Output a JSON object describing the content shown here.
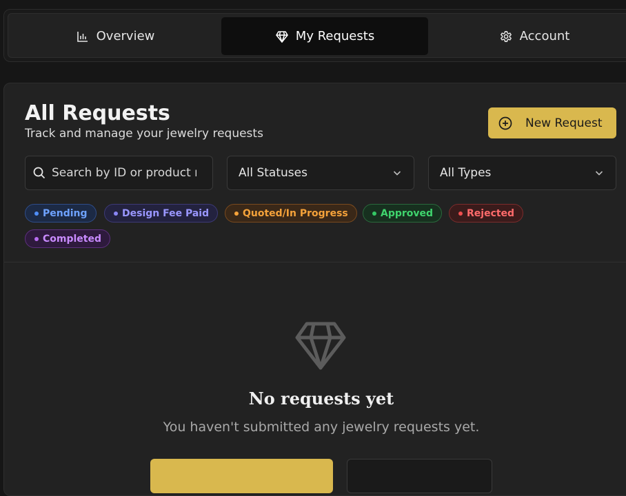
{
  "tabs": [
    {
      "label": "Overview",
      "icon": "bar-chart-icon",
      "active": false
    },
    {
      "label": "My Requests",
      "icon": "diamond-icon",
      "active": true
    },
    {
      "label": "Account",
      "icon": "gear-icon",
      "active": false
    }
  ],
  "header": {
    "title": "All Requests",
    "subtitle": "Track and manage your jewelry requests",
    "new_request_label": "New Request",
    "new_request_icon": "plus-circle-icon"
  },
  "filters": {
    "search_placeholder": "Search by ID or product name...",
    "status_select": "All Statuses",
    "type_select": "All Types"
  },
  "status_chips": [
    {
      "label": "Pending",
      "color": "#4f8ef7"
    },
    {
      "label": "Design Fee Paid",
      "color": "#8a86f5"
    },
    {
      "label": "Quoted/In Progress",
      "color": "#f5a23a"
    },
    {
      "label": "Approved",
      "color": "#34c765"
    },
    {
      "label": "Rejected",
      "color": "#f04f4f"
    },
    {
      "label": "Completed",
      "color": "#b76cf0"
    }
  ],
  "empty_state": {
    "icon": "diamond-icon",
    "title": "No requests yet",
    "description": "You haven't submitted any jewelry requests yet."
  },
  "colors": {
    "accent": "#d9b84e",
    "background": "#161616",
    "card": "#222222"
  }
}
